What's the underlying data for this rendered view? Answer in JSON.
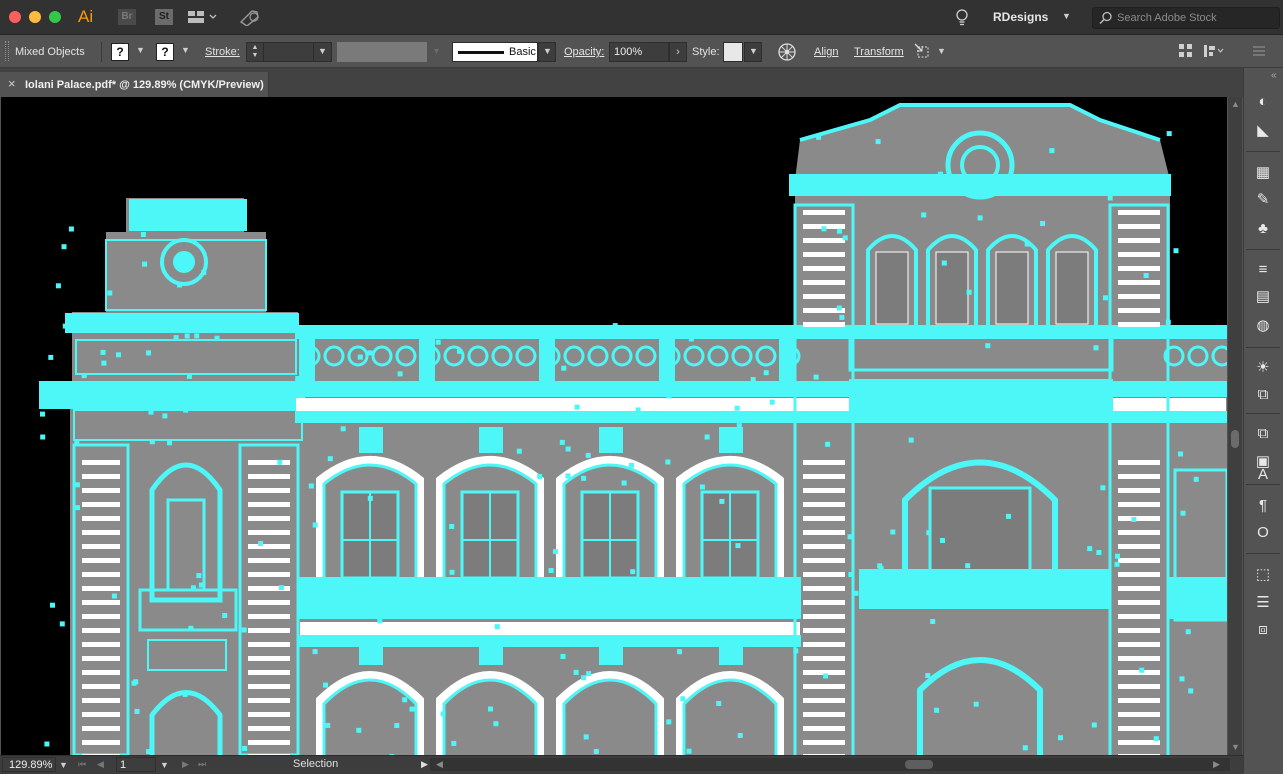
{
  "titlebar": {
    "app_ai": "Ai",
    "app_br": "Br",
    "app_st": "St",
    "workspace": "RDesigns",
    "search_placeholder": "Search Adobe Stock"
  },
  "controlbar": {
    "selection_type": "Mixed Objects",
    "fill_value": "?",
    "stroke_color_value": "?",
    "stroke_label": "Stroke:",
    "stroke_weight": "",
    "brush_label": "Basic",
    "opacity_label": "Opacity:",
    "opacity_value": "100%",
    "style_label": "Style:",
    "align_label": "Align",
    "transform_label": "Transform"
  },
  "document": {
    "tab_title": "Iolani Palace.pdf* @ 129.89% (CMYK/Preview)",
    "close_glyph": "×"
  },
  "statusbar": {
    "zoom": "129.89%",
    "artboard": "1",
    "tool": "Selection"
  },
  "colors": {
    "selection_highlight": "#4ef7f7",
    "building_gray": "#8a8a8a",
    "window_fill": "#7c7c7c",
    "canvas_bg": "#000000"
  },
  "panel_icons": [
    "color-icon",
    "color-guide-icon",
    "swatches-icon",
    "brushes-icon",
    "symbols-icon",
    "stroke-icon",
    "gradient-icon",
    "transparency-icon",
    "appearance-icon",
    "graphic-styles-icon",
    "layers-icon",
    "artboards-icon",
    "character-icon",
    "paragraph-icon",
    "opentype-icon",
    "transform-icon",
    "align-icon",
    "pathfinder-icon"
  ]
}
